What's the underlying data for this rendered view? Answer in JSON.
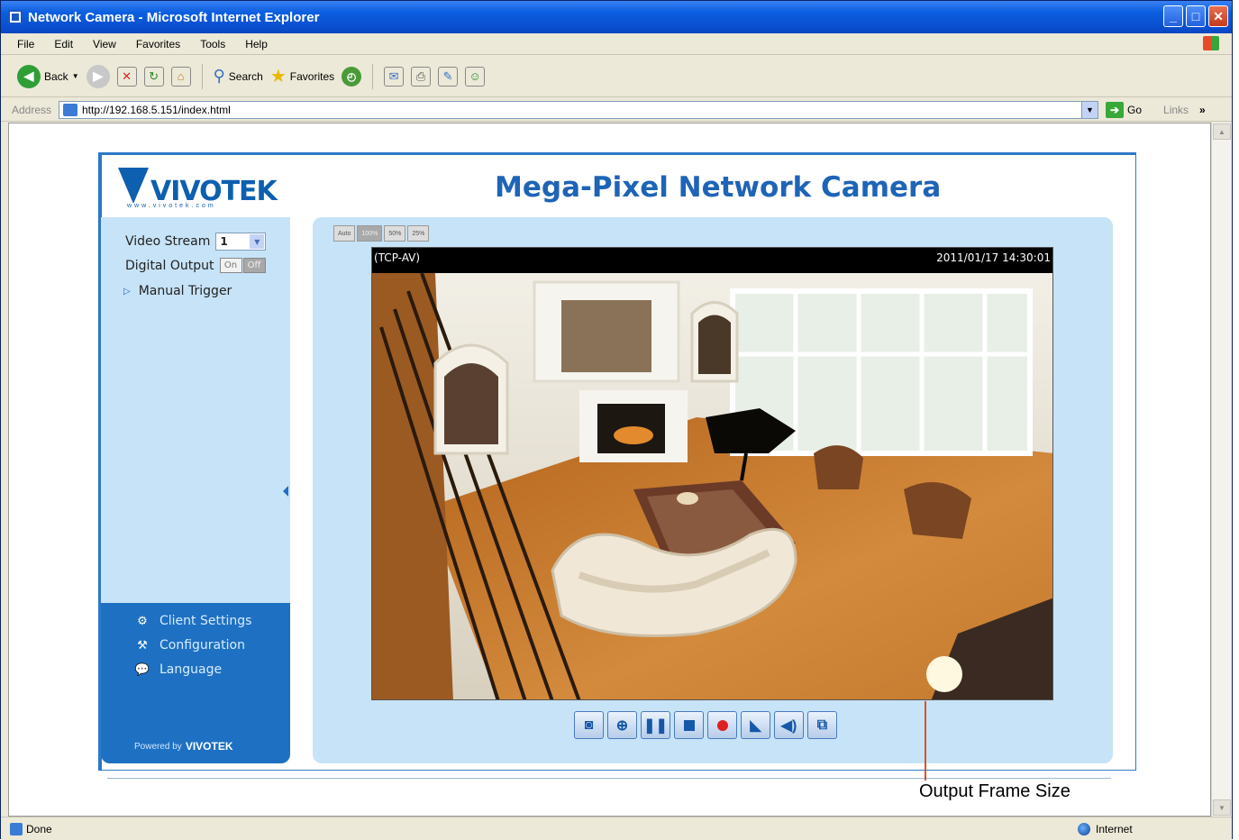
{
  "window": {
    "title": "Network Camera - Microsoft Internet Explorer"
  },
  "menu": [
    "File",
    "Edit",
    "View",
    "Favorites",
    "Tools",
    "Help"
  ],
  "toolbar": {
    "back": "Back",
    "search": "Search",
    "favorites": "Favorites"
  },
  "address": {
    "label": "Address",
    "url": "http://192.168.5.151/index.html",
    "go": "Go",
    "links": "Links"
  },
  "status": {
    "text": "Done",
    "zone": "Internet"
  },
  "camera": {
    "brand": "VIVOTEK",
    "brand_sub": "www.vivotek.com",
    "page_title": "Mega-Pixel Network Camera",
    "video_stream_label": "Video Stream",
    "video_stream_value": "1",
    "digital_output_label": "Digital Output",
    "do_on": "On",
    "do_off": "Off",
    "manual_trigger": "Manual Trigger",
    "nav": {
      "client_settings": "Client Settings",
      "configuration": "Configuration",
      "language": "Language"
    },
    "powered_by": "Powered by",
    "powered_brand": "VIVOTEK",
    "size_buttons": [
      "Auto",
      "100%",
      "50%",
      "25%"
    ],
    "video": {
      "protocol": "(TCP-AV)",
      "timestamp": "2011/01/17 14:30:01"
    }
  },
  "annotation": {
    "text": "Output Frame Size"
  }
}
